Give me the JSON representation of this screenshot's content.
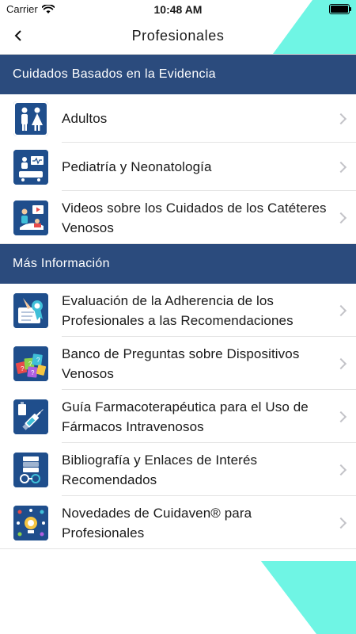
{
  "status_bar": {
    "carrier": "Carrier",
    "time": "10:48 AM"
  },
  "nav": {
    "title": "Profesionales",
    "back_icon": "chevron-left-icon"
  },
  "sections": [
    {
      "title": "Cuidados Basados en la Evidencia",
      "items": [
        {
          "label": "Adultos",
          "icon": "adults-icon"
        },
        {
          "label": "Pediatría y Neonatología",
          "icon": "pediatrics-icon"
        },
        {
          "label": "Videos sobre los Cuidados de los Catéteres Venosos",
          "icon": "video-care-icon"
        }
      ]
    },
    {
      "title": "Más Información",
      "items": [
        {
          "label": "Evaluación de la Adherencia de los Profesionales a las Recomendaciones",
          "icon": "award-ribbon-icon"
        },
        {
          "label": "Banco de Preguntas sobre Dispositivos Venosos",
          "icon": "question-cards-icon"
        },
        {
          "label": "Guía Farmacoterapéutica para el Uso de Fármacos Intravenosos",
          "icon": "syringe-icon"
        },
        {
          "label": "Bibliografía y Enlaces de Interés Recomendados",
          "icon": "bibliography-icon"
        },
        {
          "label": "Novedades de Cuidaven® para Profesionales",
          "icon": "news-bulb-icon"
        }
      ]
    }
  ],
  "colors": {
    "section_header": "#2b4b7d",
    "accent": "#6ff5e4",
    "icon_bg": "#1f4e8c"
  }
}
